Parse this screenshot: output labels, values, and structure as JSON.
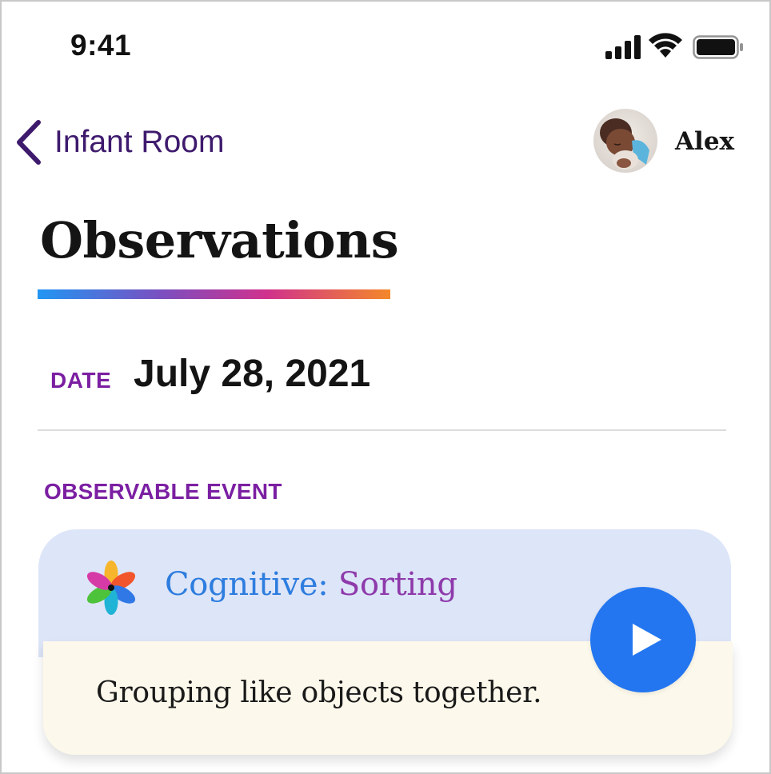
{
  "status_bar": {
    "time": "9:41",
    "icons": [
      "signal-icon",
      "wifi-icon",
      "battery-icon"
    ]
  },
  "nav": {
    "back_label": "Infant Room",
    "back_icon": "chevron-left-icon",
    "user_name": "Alex",
    "avatar": "child-avatar"
  },
  "page": {
    "title": "Observations"
  },
  "date": {
    "label": "DATE",
    "value": "July 28, 2021"
  },
  "event_section": {
    "label": "OBSERVABLE EVENT"
  },
  "event_card": {
    "icon": "flower-icon",
    "category": "Cognitive:",
    "name": "Sorting",
    "description": "Grouping like objects together.",
    "play_icon": "play-icon"
  },
  "colors": {
    "accent_purple": "#7b1fa2",
    "nav_purple": "#3e1a6d",
    "category_blue": "#2d7ddf",
    "name_purple": "#8e3aab",
    "play_blue": "#2376f0",
    "card_header_bg": "#dde5f8",
    "card_body_bg": "#fcf8eb"
  }
}
